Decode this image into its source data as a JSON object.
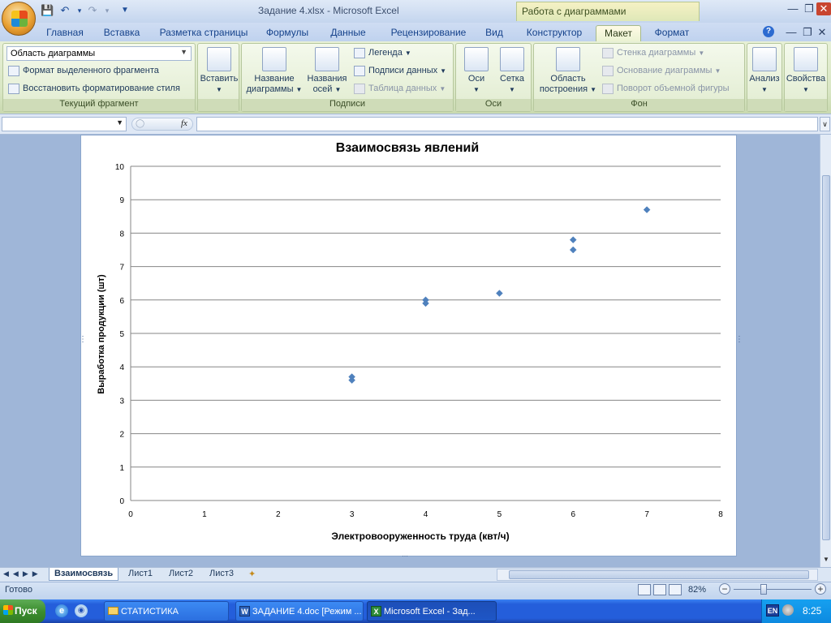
{
  "window": {
    "title": "Задание 4.xlsx - Microsoft Excel",
    "context_tab_group": "Работа с диаграммами"
  },
  "ribbon_tabs": [
    "Главная",
    "Вставка",
    "Разметка страницы",
    "Формулы",
    "Данные",
    "Рецензирование",
    "Вид",
    "Конструктор",
    "Макет",
    "Формат"
  ],
  "ribbon": {
    "current_selection": {
      "dropdown_value": "Область диаграммы",
      "format_selection": "Формат выделенного фрагмента",
      "reset_style": "Восстановить форматирование стиля",
      "group_label": "Текущий фрагмент"
    },
    "insert": {
      "label": "Вставить"
    },
    "labels_group": {
      "chart_title": "Название диаграммы",
      "chart_title_l1": "Название",
      "chart_title_l2": "диаграммы",
      "axis_titles_l1": "Названия",
      "axis_titles_l2": "осей",
      "legend": "Легенда",
      "data_labels": "Подписи данных",
      "data_table": "Таблица данных",
      "group_label": "Подписи"
    },
    "axes_group": {
      "axes": "Оси",
      "gridlines": "Сетка",
      "group_label": "Оси"
    },
    "background_group": {
      "plot_area_l1": "Область",
      "plot_area_l2": "построения",
      "chart_wall": "Стенка диаграммы",
      "chart_floor": "Основание диаграммы",
      "rotation_3d": "Поворот объемной фигуры",
      "group_label": "Фон"
    },
    "analysis": {
      "label": "Анализ"
    },
    "properties": {
      "label": "Свойства"
    }
  },
  "formula_bar": {
    "name_box": "",
    "fx": "fx",
    "content": ""
  },
  "chart_data": {
    "type": "scatter",
    "title": "Взаимосвязь явлений",
    "xlabel": "Электровооруженность  труда (квт/ч)",
    "ylabel": "Выработка продукции (шт)",
    "xlim": [
      0,
      8
    ],
    "ylim": [
      0,
      10
    ],
    "xticks": [
      "0",
      "1",
      "2",
      "3",
      "4",
      "5",
      "6",
      "7",
      "8"
    ],
    "yticks": [
      "0",
      "1",
      "2",
      "3",
      "4",
      "5",
      "6",
      "7",
      "8",
      "9",
      "10"
    ],
    "grid": "horizontal",
    "marker_color": "#4f81bd",
    "points": [
      {
        "x": 3,
        "y": 3.7
      },
      {
        "x": 3,
        "y": 3.6
      },
      {
        "x": 4,
        "y": 6.0
      },
      {
        "x": 4,
        "y": 5.9
      },
      {
        "x": 5,
        "y": 6.2
      },
      {
        "x": 6,
        "y": 7.8
      },
      {
        "x": 6,
        "y": 7.5
      },
      {
        "x": 7,
        "y": 8.7
      }
    ]
  },
  "sheet_tabs": [
    "Взаимосвязь",
    "Лист1",
    "Лист2",
    "Лист3"
  ],
  "status": {
    "ready": "Готово",
    "zoom": "82%"
  },
  "taskbar": {
    "start": "Пуск",
    "items": [
      "СТАТИСТИКА",
      "ЗАДАНИЕ 4.doc [Режим ...",
      "Microsoft Excel - Зад..."
    ],
    "lang": "EN",
    "clock": "8:25"
  }
}
